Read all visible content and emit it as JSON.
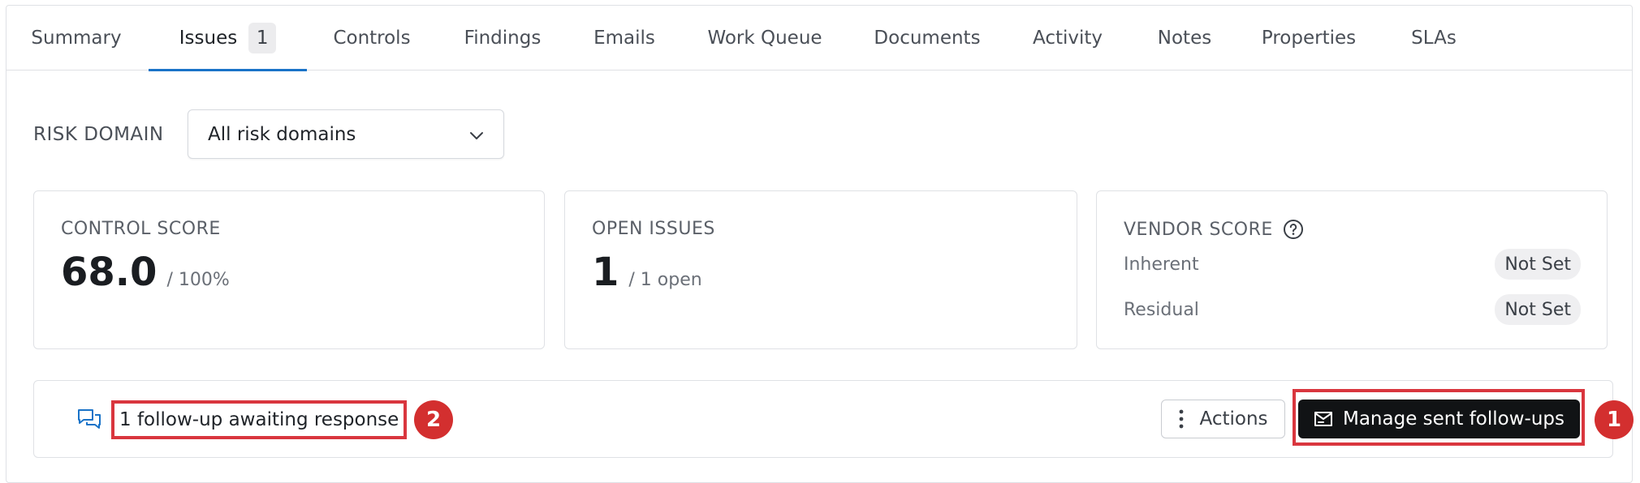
{
  "tabs": [
    {
      "label": "Summary"
    },
    {
      "label": "Issues",
      "badge": "1",
      "active": true
    },
    {
      "label": "Controls"
    },
    {
      "label": "Findings"
    },
    {
      "label": "Emails"
    },
    {
      "label": "Work Queue"
    },
    {
      "label": "Documents"
    },
    {
      "label": "Activity"
    },
    {
      "label": "Notes"
    },
    {
      "label": "Properties"
    },
    {
      "label": "SLAs"
    }
  ],
  "filter": {
    "label": "RISK DOMAIN",
    "selected": "All risk domains"
  },
  "cards": {
    "control_score": {
      "title": "CONTROL SCORE",
      "value": "68.0",
      "suffix": "/ 100%"
    },
    "open_issues": {
      "title": "OPEN ISSUES",
      "value": "1",
      "suffix": "/ 1 open"
    },
    "vendor_score": {
      "title": "VENDOR SCORE",
      "inherent_label": "Inherent",
      "inherent_value": "Not Set",
      "residual_label": "Residual",
      "residual_value": "Not Set"
    }
  },
  "followup_bar": {
    "text": "1 follow-up awaiting response",
    "actions_label": "Actions",
    "manage_label": "Manage sent follow-ups",
    "marker_manage": "1",
    "marker_text": "2"
  },
  "colors": {
    "accent": "#1a73c8",
    "marker": "#d32f2f",
    "primary_button": "#111315"
  }
}
